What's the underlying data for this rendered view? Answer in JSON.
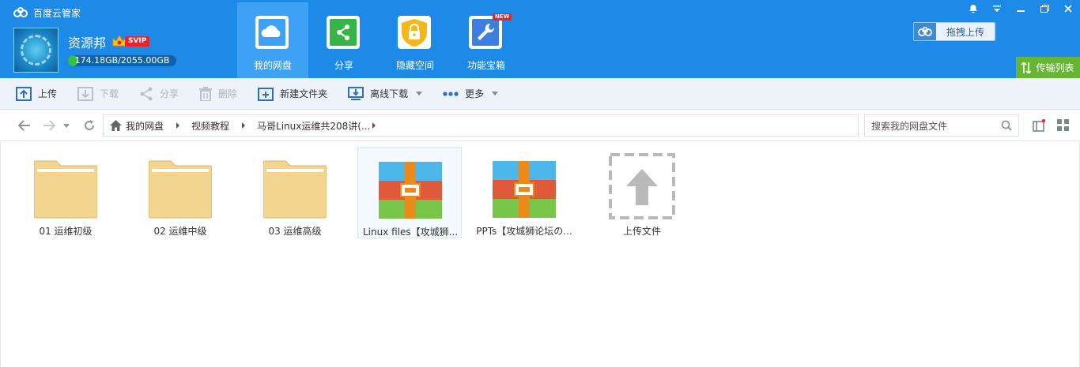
{
  "app": {
    "title": "百度云管家"
  },
  "user": {
    "name": "资源邦",
    "vip_badge": "SVIP",
    "quota_text": "174.18GB/2055.00GB",
    "quota_used_fraction": 0.085
  },
  "nav": {
    "tabs": [
      {
        "label": "我的网盘",
        "icon": "cloud-drive-icon",
        "active": true
      },
      {
        "label": "分享",
        "icon": "share-icon",
        "active": false
      },
      {
        "label": "隐藏空间",
        "icon": "lock-icon",
        "active": false
      },
      {
        "label": "功能宝箱",
        "icon": "wrench-icon",
        "active": false,
        "badge": "NEW"
      }
    ]
  },
  "header_actions": {
    "drag_upload": "拖拽上传",
    "transfer_list": "传输列表"
  },
  "toolbar": {
    "upload": "上传",
    "download": "下载",
    "share": "分享",
    "delete": "删除",
    "new_folder": "新建文件夹",
    "offline_download": "离线下载",
    "more": "更多"
  },
  "breadcrumb": {
    "items": [
      "我的网盘",
      "视频教程",
      "马哥Linux运维共208讲(..."
    ]
  },
  "search": {
    "placeholder": "搜索我的网盘文件"
  },
  "files": [
    {
      "name": "01 运维初级",
      "type": "folder"
    },
    {
      "name": "02 运维中级",
      "type": "folder"
    },
    {
      "name": "03 运维高级",
      "type": "folder"
    },
    {
      "name": "Linux files【攻城狮...",
      "type": "archive",
      "selected": true
    },
    {
      "name": "PPTs【攻城狮论坛の...",
      "type": "archive"
    },
    {
      "name": "上传文件",
      "type": "upload-placeholder"
    }
  ],
  "colors": {
    "header_bg": "#1d8ae8",
    "active_tab_bg": "#3fa1f4",
    "transfer_btn": "#66b535",
    "toolbar_bg": "#eef3f9"
  }
}
